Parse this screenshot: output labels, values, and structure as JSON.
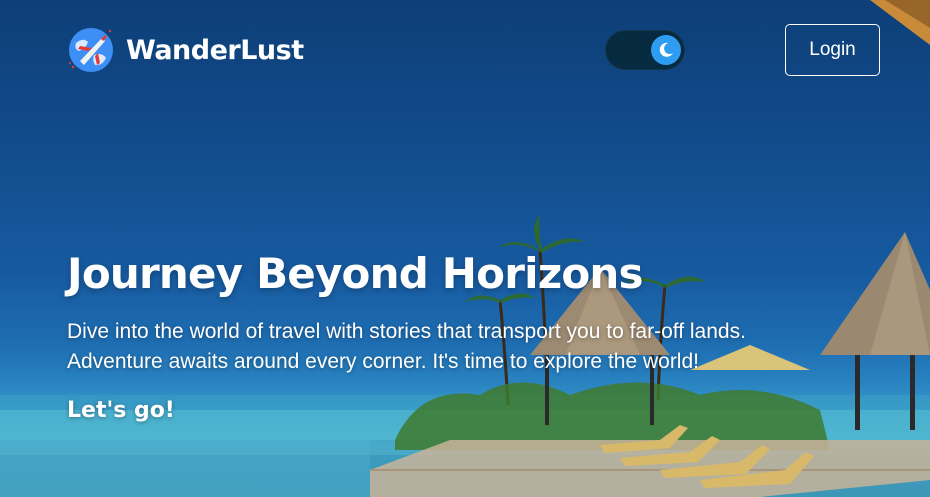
{
  "navbar": {
    "brand_name": "WanderLust",
    "logo_icon": "globe-airplane-icon",
    "theme_toggle": {
      "state": "dark",
      "icon": "moon-icon"
    },
    "login_label": "Login"
  },
  "hero": {
    "title": "Journey Beyond Horizons",
    "description": "Dive into the world of travel with stories that transport you to far-off lands. Adventure awaits around every corner. It's time to explore the world!",
    "cta_label": "Let's go!"
  },
  "colors": {
    "overlay_blue": "#124c8c",
    "toggle_track": "#062a3f",
    "toggle_knob": "#2e9cf0",
    "text": "#ffffff"
  }
}
